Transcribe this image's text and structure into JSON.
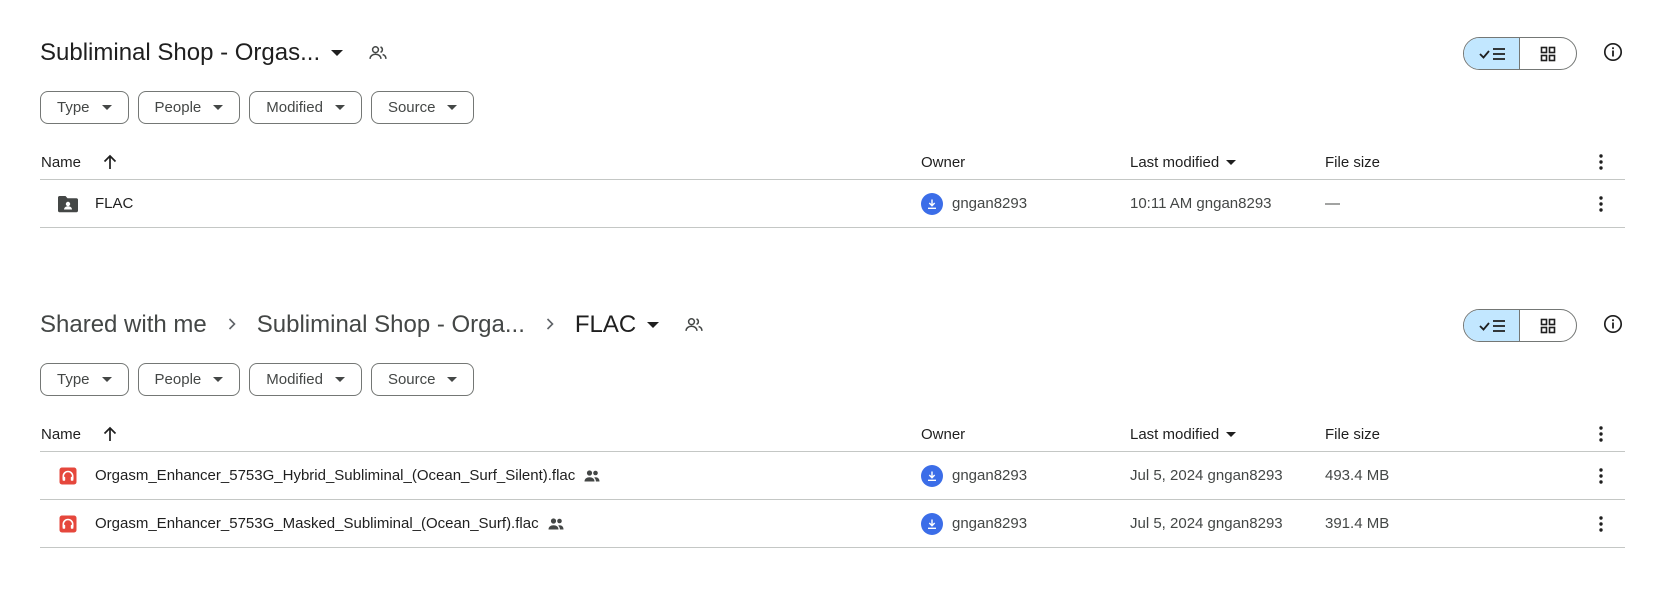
{
  "panel_a": {
    "title": "Subliminal Shop - Orgas...",
    "filters": [
      "Type",
      "People",
      "Modified",
      "Source"
    ],
    "headers": {
      "name": "Name",
      "owner": "Owner",
      "modified": "Last modified",
      "size": "File size"
    },
    "rows": [
      {
        "icon": "shared-folder-icon",
        "name": "FLAC",
        "owner": "gngan8293",
        "modified": "10:11 AM gngan8293",
        "size": "—"
      }
    ]
  },
  "panel_b": {
    "breadcrumb": [
      "Shared with me",
      "Subliminal Shop - Orga...",
      "FLAC"
    ],
    "filters": [
      "Type",
      "People",
      "Modified",
      "Source"
    ],
    "headers": {
      "name": "Name",
      "owner": "Owner",
      "modified": "Last modified",
      "size": "File size"
    },
    "rows": [
      {
        "icon": "audio-file-icon",
        "name": "Orgasm_Enhancer_5753G_Hybrid_Subliminal_(Ocean_Surf_Silent).flac",
        "owner": "gngan8293",
        "modified": "Jul 5, 2024 gngan8293",
        "size": "493.4 MB"
      },
      {
        "icon": "audio-file-icon",
        "name": "Orgasm_Enhancer_5753G_Masked_Subliminal_(Ocean_Surf).flac",
        "owner": "gngan8293",
        "modified": "Jul 5, 2024 gngan8293",
        "size": "391.4 MB"
      }
    ]
  },
  "colors": {
    "accent": "#c2e7ff",
    "avatar": "#3b6de8",
    "audio_icon": "#e5473c",
    "border": "#c4c7c5"
  }
}
